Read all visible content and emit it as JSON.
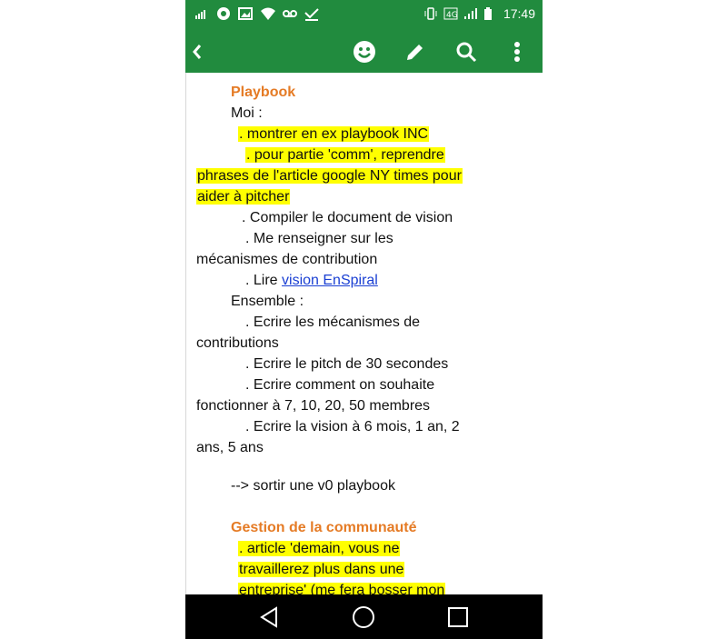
{
  "status_bar": {
    "time": "17:49"
  },
  "doc": {
    "lines": [
      {
        "text": "Playbook",
        "type": "heading"
      },
      {
        "text": "Moi :"
      },
      {
        "text": ". montrer en ex playbook INC",
        "highlight": true
      },
      {
        "text": ". pour partie 'comm', reprendre",
        "highlight": true
      },
      {
        "text": "phrases de l'article google NY times pour",
        "highlight": true
      },
      {
        "text": "aider à pitcher",
        "highlight": true
      },
      {
        "text": ". Compiler le document de vision"
      },
      {
        "text": ". Me renseigner sur les"
      },
      {
        "text": "mécanismes de contribution"
      },
      {
        "text": ". Lire ",
        "link": "vision EnSpiral"
      },
      {
        "text": "Ensemble :"
      },
      {
        "text": ". Ecrire les mécanismes de"
      },
      {
        "text": "contributions"
      },
      {
        "text": ". Ecrire le pitch de 30 secondes"
      },
      {
        "text": ". Ecrire comment on souhaite"
      },
      {
        "text": "fonctionner à 7, 10, 20, 50 membres"
      },
      {
        "text": ". Ecrire la vision à 6 mois, 1 an, 2"
      },
      {
        "text": "ans, 5 ans"
      },
      {
        "text": ""
      },
      {
        "text": "--> sortir une v0 playbook"
      },
      {
        "text": ""
      },
      {
        "text": "Gestion de la communauté",
        "type": "heading"
      },
      {
        "text": ". article 'demain, vous ne",
        "highlight": true
      },
      {
        "text": "travaillerez plus dans une",
        "highlight": true
      },
      {
        "text": "entreprise' (me fera bosser mon",
        "highlight": true
      }
    ]
  },
  "icons": {
    "status_left": [
      "signal-bars-icon",
      "chat-bubble-icon",
      "image-icon",
      "wifi-question-icon",
      "voicemail-icon",
      "check-download-icon"
    ],
    "status_right": [
      "vibrate-icon",
      "data-4g-icon",
      "cell-signal-icon",
      "battery-icon"
    ],
    "appbar": [
      "back-icon",
      "emoji-icon",
      "edit-pencil-icon",
      "search-icon",
      "more-vert-icon"
    ],
    "navbar": [
      "nav-back-icon",
      "nav-home-icon",
      "nav-recents-icon"
    ]
  },
  "colors": {
    "accent": "#218b3e",
    "heading": "#e57b25",
    "highlight": "#ffff00",
    "link": "#1a3fd3"
  }
}
